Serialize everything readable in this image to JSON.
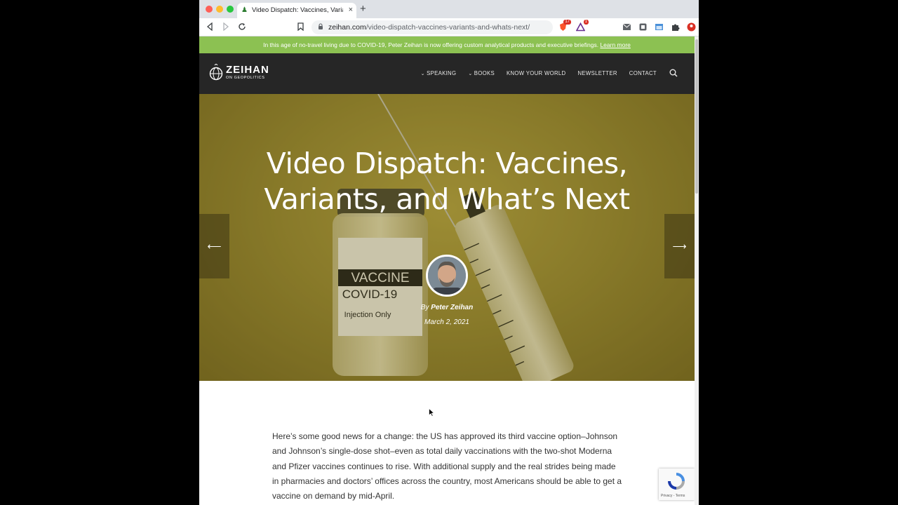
{
  "browser": {
    "tab_title": "Video Dispatch: Vaccines, Varia",
    "tab_close": "×",
    "new_tab": "+",
    "url_domain": "zeihan.com",
    "url_path": "/video-dispatch-vaccines-variants-and-whats-next/",
    "extensions": [
      {
        "icon": "brave-shield-icon",
        "badge": "17"
      },
      {
        "icon": "brave-rewards-icon",
        "badge": "1"
      }
    ]
  },
  "banner": {
    "text": "In this age of no-travel living due to COVID-19, Peter Zeihan is now offering custom analytical products and executive briefings.",
    "link": "Learn more"
  },
  "site": {
    "logo_title": "ZEIHAN",
    "logo_subtitle": "ON GEOPOLITICS",
    "nav": {
      "speaking": "SPEAKING",
      "books": "BOOKS",
      "know_your_world": "KNOW YOUR WORLD",
      "newsletter": "NEWSLETTER",
      "contact": "CONTACT"
    }
  },
  "hero": {
    "title": "Video Dispatch: Vaccines, Variants, and What’s Next",
    "by": "By",
    "author": "Peter Zeihan",
    "date": "March 2, 2021",
    "vial_label_line1": "VACCINE",
    "vial_label_line2": "COVID-19",
    "vial_label_line3": "Injection Only",
    "prev_arrow": "⟵",
    "next_arrow": "⟶"
  },
  "article": {
    "paragraph": "Here’s some good news for a change: the US has approved its third vaccine option–Johnson and Johnson’s single-dose shot–even as total daily vaccinations with the two-shot Moderna and Pfizer vaccines continues to rise. With additional supply and the real strides being made in pharmacies and doctors’ offices across the country, most Americans should be able to get a vaccine on demand by mid-April."
  },
  "recaptcha": {
    "terms": "Privacy - Terms"
  },
  "colors": {
    "banner": "#8cc152",
    "header": "#262626",
    "hero_base": "#9c8c35"
  }
}
